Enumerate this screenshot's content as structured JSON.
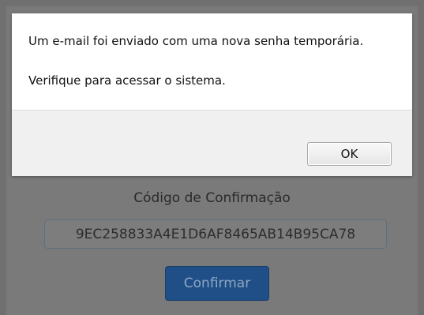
{
  "dialog": {
    "message_line1": "Um e-mail foi enviado com uma nova senha temporária.",
    "message_line2": "Verifique para acessar o sistema.",
    "ok_label": "OK"
  },
  "form": {
    "label": "Código de Confirmação",
    "code_value": "9EC258833A4E1D6AF8465AB14B95CA78",
    "confirm_label": "Confirmar"
  },
  "colors": {
    "overlay": "#7a7a7a",
    "dialog_bg": "#ffffff",
    "footer_bg": "#f0f0f0",
    "confirm_button_bg": "#1f4f86"
  }
}
